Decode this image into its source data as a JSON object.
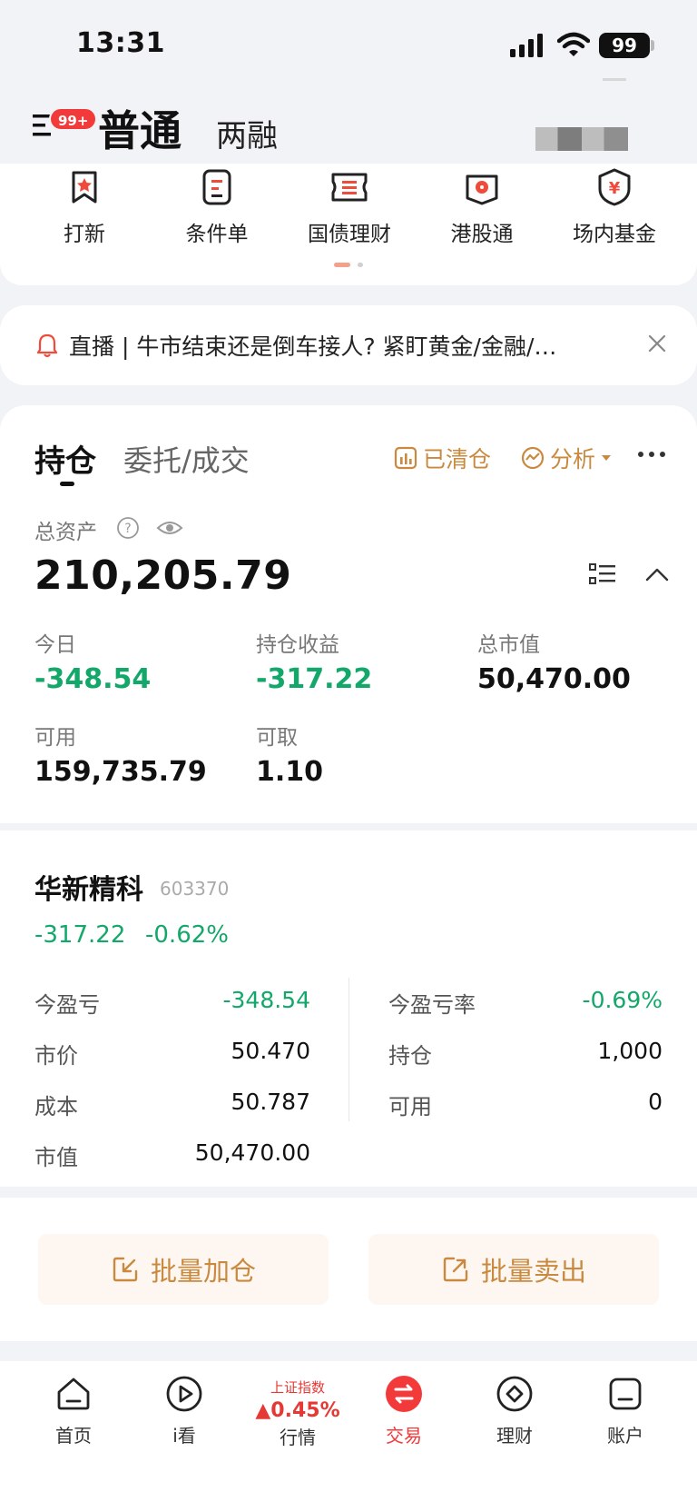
{
  "status_bar": {
    "time": "13:31",
    "battery": "99"
  },
  "header": {
    "badge": "99+",
    "tab_normal": "普通",
    "tab_margin": "两融"
  },
  "quick_menu": [
    {
      "label": "打新",
      "icon": "ipo-flag-icon"
    },
    {
      "label": "条件单",
      "icon": "condition-order-icon"
    },
    {
      "label": "国债理财",
      "icon": "bond-ticket-icon"
    },
    {
      "label": "港股通",
      "icon": "hk-connect-icon"
    },
    {
      "label": "场内基金",
      "icon": "fund-shield-icon"
    }
  ],
  "notice": {
    "text": "直播 | 牛市结束还是倒车接人? 紧盯黄金/金融/…"
  },
  "holdings": {
    "tab_positions": "持仓",
    "tab_orders": "委托/成交",
    "cleared_label": "已清仓",
    "analysis_label": "分析",
    "total_assets_label": "总资产",
    "total_assets": "210,205.79",
    "stats": [
      {
        "label": "今日",
        "value": "-348.54",
        "negative": true
      },
      {
        "label": "持仓收益",
        "value": "-317.22",
        "negative": true
      },
      {
        "label": "总市值",
        "value": "50,470.00",
        "negative": false
      },
      {
        "label": "可用",
        "value": "159,735.79",
        "negative": false
      },
      {
        "label": "可取",
        "value": "1.10",
        "negative": false
      }
    ]
  },
  "stock": {
    "name": "华新精科",
    "code": "603370",
    "pnl": "-317.22",
    "pnl_rate": "-0.62%",
    "left": [
      {
        "label": "今盈亏",
        "value": "-348.54",
        "negative": true
      },
      {
        "label": "市价",
        "value": "50.470",
        "negative": false
      },
      {
        "label": "成本",
        "value": "50.787",
        "negative": false
      },
      {
        "label": "市值",
        "value": "50,470.00",
        "negative": false
      }
    ],
    "right": [
      {
        "label": "今盈亏率",
        "value": "-0.69%",
        "negative": true
      },
      {
        "label": "持仓",
        "value": "1,000",
        "negative": false
      },
      {
        "label": "可用",
        "value": "0",
        "negative": false
      }
    ]
  },
  "batch": {
    "add_label": "批量加仓",
    "sell_label": "批量卖出"
  },
  "bottom_nav": {
    "home": "首页",
    "watch": "i看",
    "market_index": "上证指数",
    "market_change": "▲0.45%",
    "market": "行情",
    "trade": "交易",
    "wealth": "理财",
    "account": "账户"
  },
  "colors": {
    "accent": "#f23a3a",
    "gold": "#c98a3f",
    "loss_green": "#13a86a",
    "market_red": "#e53935"
  }
}
